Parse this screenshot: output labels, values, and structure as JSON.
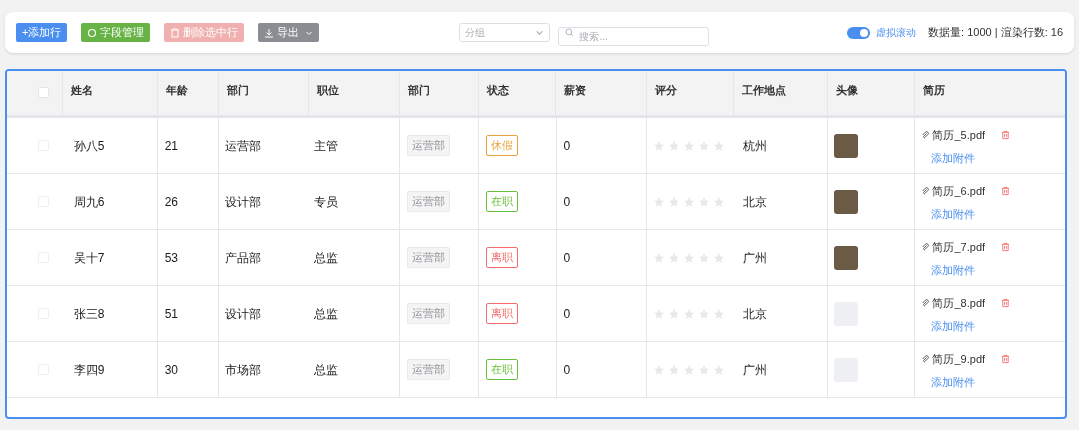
{
  "toolbar": {
    "buttons": [
      {
        "kind": "add",
        "label": "+添加行"
      },
      {
        "kind": "fields",
        "label": "字段管理"
      },
      {
        "kind": "delete",
        "label": "删除选中行"
      },
      {
        "kind": "export",
        "label": "导出"
      }
    ],
    "group_select": {
      "placeholder": "分组"
    },
    "search": {
      "placeholder": "搜索..."
    },
    "virtual_scroll": {
      "label": "虚拟滚动",
      "on": true
    },
    "stats": "数据量: 1000 | 渲染行数: 16"
  },
  "table": {
    "select_all": {
      "checked": false
    },
    "columns": [
      "姓名",
      "年龄",
      "部门",
      "职位",
      "部门",
      "状态",
      "薪资",
      "评分",
      "工作地点",
      "头像",
      "简历"
    ],
    "rows": [
      {
        "checked": false,
        "name": "孙八5",
        "age": "21",
        "dept": "运营部",
        "title": "主管",
        "dept_tag": "运营部",
        "status": "休假",
        "color": "#e6a23c",
        "salary": "0",
        "stars": 0,
        "location": "杭州",
        "has_photo": true,
        "file": "简历_5.pdf",
        "attach": "添加附件"
      },
      {
        "checked": false,
        "name": "周九6",
        "age": "26",
        "dept": "设计部",
        "title": "专员",
        "dept_tag": "运营部",
        "status": "在职",
        "color": "#67c23a",
        "salary": "0",
        "stars": 0,
        "location": "北京",
        "has_photo": true,
        "file": "简历_6.pdf",
        "attach": "添加附件"
      },
      {
        "checked": false,
        "name": "吴十7",
        "age": "53",
        "dept": "产品部",
        "title": "总监",
        "dept_tag": "运营部",
        "status": "离职",
        "color": "#f56c6c",
        "salary": "0",
        "stars": 0,
        "location": "广州",
        "has_photo": true,
        "file": "简历_7.pdf",
        "attach": "添加附件"
      },
      {
        "checked": false,
        "name": "张三8",
        "age": "51",
        "dept": "设计部",
        "title": "总监",
        "dept_tag": "运营部",
        "status": "离职",
        "color": "#f56c6c",
        "salary": "0",
        "stars": 0,
        "location": "北京",
        "has_photo": false,
        "file": "简历_8.pdf",
        "attach": "添加附件"
      },
      {
        "checked": false,
        "name": "李四9",
        "age": "30",
        "dept": "市场部",
        "title": "总监",
        "dept_tag": "运营部",
        "status": "在职",
        "color": "#67c23a",
        "salary": "0",
        "stars": 0,
        "location": "广州",
        "has_photo": false,
        "file": "简历_9.pdf",
        "attach": "添加附件"
      }
    ]
  }
}
